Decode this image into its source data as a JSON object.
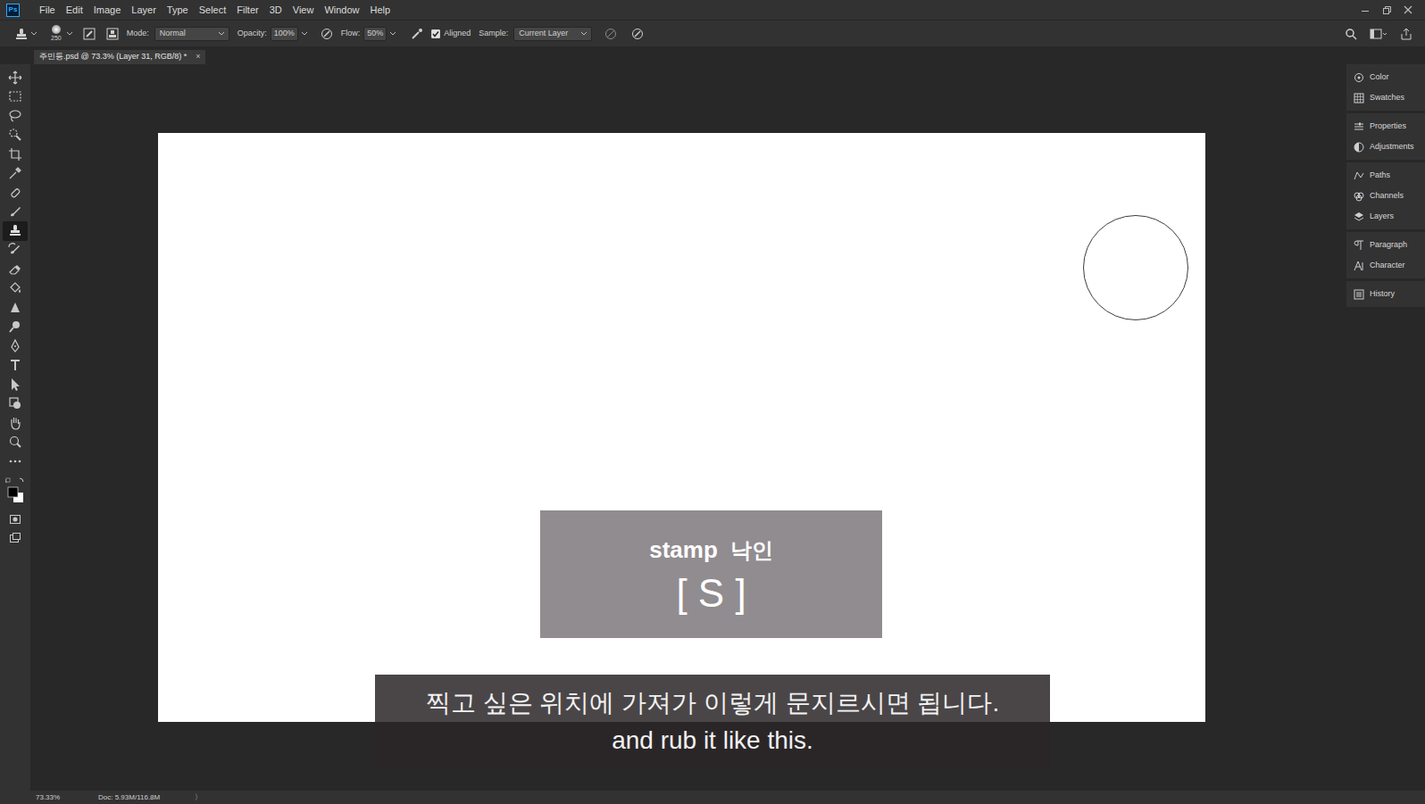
{
  "app": {
    "logo": "Ps"
  },
  "menu": [
    "File",
    "Edit",
    "Image",
    "Layer",
    "Type",
    "Select",
    "Filter",
    "3D",
    "View",
    "Window",
    "Help"
  ],
  "options_bar": {
    "brush_size": "250",
    "mode_label": "Mode:",
    "mode": "Normal",
    "opacity_label": "Opacity:",
    "opacity": "100%",
    "flow_label": "Flow:",
    "flow": "50%",
    "aligned": {
      "label": "Aligned",
      "checked": true
    },
    "sample_label": "Sample:",
    "sample": "Current Layer"
  },
  "document_tab": {
    "title": "주민등.psd @ 73.3% (Layer 31, RGB/8) *",
    "close": "×"
  },
  "tools": [
    {
      "selected": false
    },
    {
      "selected": false
    },
    {
      "selected": false
    },
    {
      "selected": false
    },
    {
      "selected": false
    },
    {
      "selected": false
    },
    {
      "selected": false
    },
    {
      "selected": false
    },
    {
      "selected": true
    },
    {
      "selected": false
    },
    {
      "selected": false
    },
    {
      "selected": false
    },
    {
      "selected": false
    },
    {
      "selected": false
    },
    {
      "selected": false
    },
    {
      "selected": false
    },
    {
      "selected": false
    },
    {
      "selected": false
    },
    {
      "selected": false
    },
    {
      "selected": false
    },
    {
      "selected": false
    }
  ],
  "panels": [
    [
      {
        "label": "Color"
      },
      {
        "label": "Swatches"
      }
    ],
    [
      {
        "label": "Properties"
      },
      {
        "label": "Adjustments"
      }
    ],
    [
      {
        "label": "Paths"
      },
      {
        "label": "Channels"
      },
      {
        "label": "Layers"
      }
    ],
    [
      {
        "label": "Paragraph"
      },
      {
        "label": "Character"
      }
    ],
    [
      {
        "label": "History"
      }
    ]
  ],
  "overlay_caption": {
    "english": "stamp",
    "korean": "낙인",
    "key": "[ S ]"
  },
  "subtitles": [
    "찍고 싶은 위치에 가져가 이렇게 문지르시면 됩니다.",
    "and rub it like this."
  ],
  "status_bar": {
    "zoom": "73.33%",
    "doc": "Doc: 5.93M/116.8M",
    "arrow": "〉"
  }
}
